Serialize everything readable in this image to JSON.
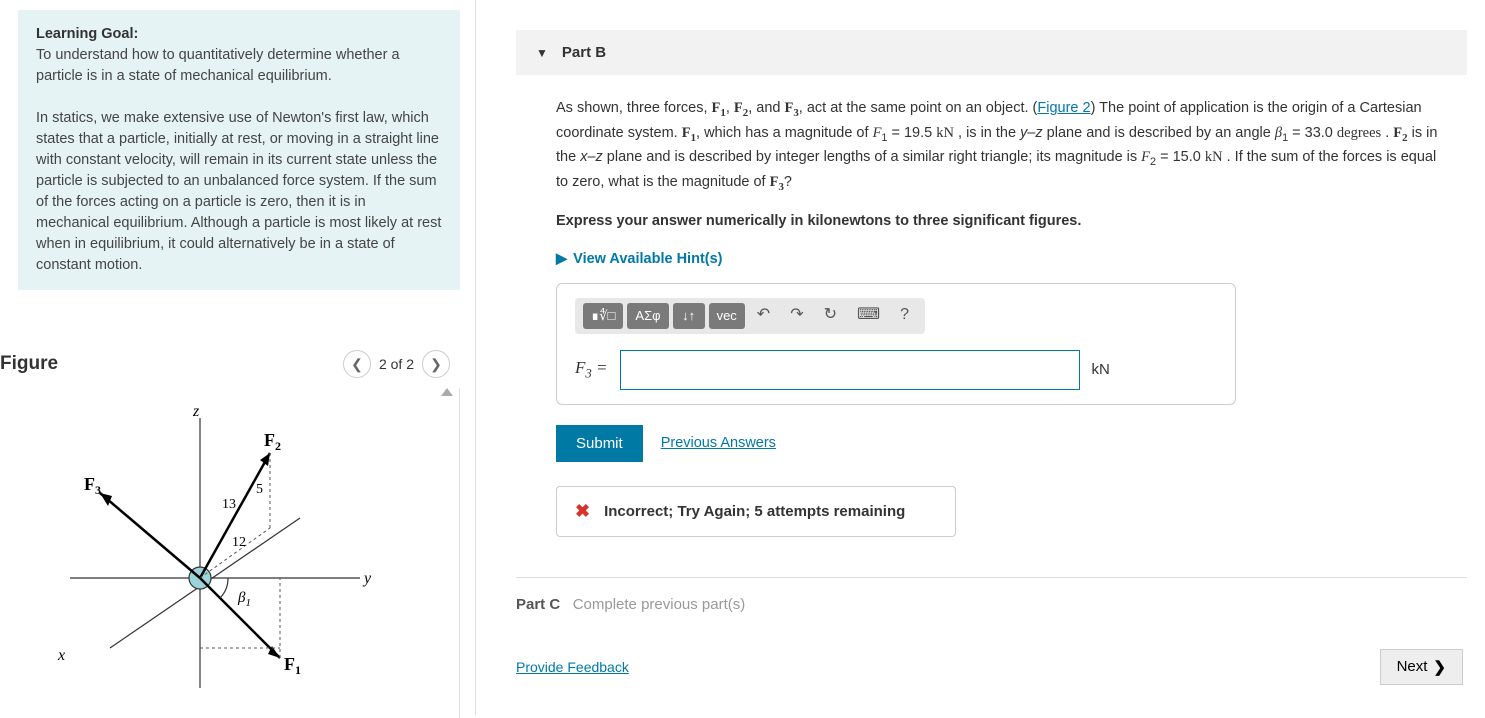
{
  "left": {
    "learning_goal_label": "Learning Goal:",
    "learning_goal_text": "To understand how to quantitatively determine whether a particle is in a state of mechanical equilibrium.",
    "learning_goal_body": "In statics, we make extensive use of Newton's first law, which states that a particle, initially at rest, or moving in a straight line with constant velocity, will remain in its current state unless the particle is subjected to an unbalanced force system. If the sum of the forces acting on a particle is zero, then it is in mechanical equilibrium. Although a particle is most likely at rest when in equilibrium, it could alternatively be in a state of constant motion.",
    "figure_label": "Figure",
    "figure_page": "2 of 2",
    "diagram": {
      "axes": {
        "x": "x",
        "y": "y",
        "z": "z"
      },
      "F1": "F",
      "F1_sub": "1",
      "F2": "F",
      "F2_sub": "2",
      "F3": "F",
      "F3_sub": "3",
      "tri_hyp": "13",
      "tri_opp": "5",
      "tri_adj": "12",
      "beta": "β",
      "beta_sub": "1"
    }
  },
  "partB": {
    "title": "Part B",
    "text_1": "As shown, three forces, ",
    "text_2": ", ",
    "text_3": ", and ",
    "text_4": ", act at the same point on an object. (",
    "fig_link": "Figure 2",
    "text_5": ") The point of application is the origin of a Cartesian coordinate system. ",
    "text_6": ", which has a magnitude of ",
    "F1_val": "F₁ = 19.5 kN",
    "text_7": " , is in the ",
    "yz": "y–z",
    "text_8": " plane and is described by an angle ",
    "beta_val": "β₁ = 33.0 degrees",
    "text_9": " .  ",
    "text_10": " is in the ",
    "xz": "x–z",
    "text_11": " plane and is described by integer lengths of a similar right triangle; its magnitude is ",
    "F2_val": "F₂ = 15.0 kN",
    "text_12": " . If the sum of the forces is equal to zero, what is the magnitude of ",
    "text_13": "?",
    "instruct": "Express your answer numerically in kilonewtons to three significant figures.",
    "hints": "View Available Hint(s)",
    "toolbar": {
      "templates": "∎∜□",
      "greek": "ΑΣφ",
      "subsup": "↓↑",
      "vec": "vec",
      "help": "?"
    },
    "var": "F₃ =",
    "unit": "kN",
    "submit": "Submit",
    "prev_answers": "Previous Answers",
    "feedback": "Incorrect; Try Again; 5 attempts remaining"
  },
  "partC": {
    "label": "Part C",
    "status": "Complete previous part(s)"
  },
  "footer": {
    "feedback": "Provide Feedback",
    "next": "Next"
  }
}
